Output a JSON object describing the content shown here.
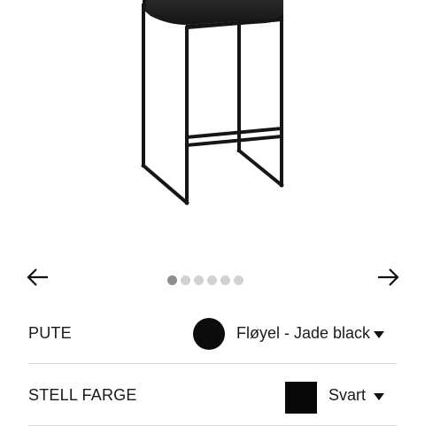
{
  "gallery": {
    "image_alt": "Bar stool",
    "dot_count": 6,
    "active_index": 0,
    "prev_icon": "arrow-left-icon",
    "next_icon": "arrow-right-icon"
  },
  "options": [
    {
      "label": "PUTE",
      "value": "Fløyel - Jade black",
      "swatch": "circle",
      "swatch_color": "#0c0c0c"
    },
    {
      "label": "STELL FARGE",
      "value": "Svart",
      "swatch": "square",
      "swatch_color": "#080808"
    }
  ],
  "colors": {
    "divider": "#d9d9d9",
    "dot_active": "#8e8e8e",
    "dot_inactive": "#d2d2d2"
  }
}
